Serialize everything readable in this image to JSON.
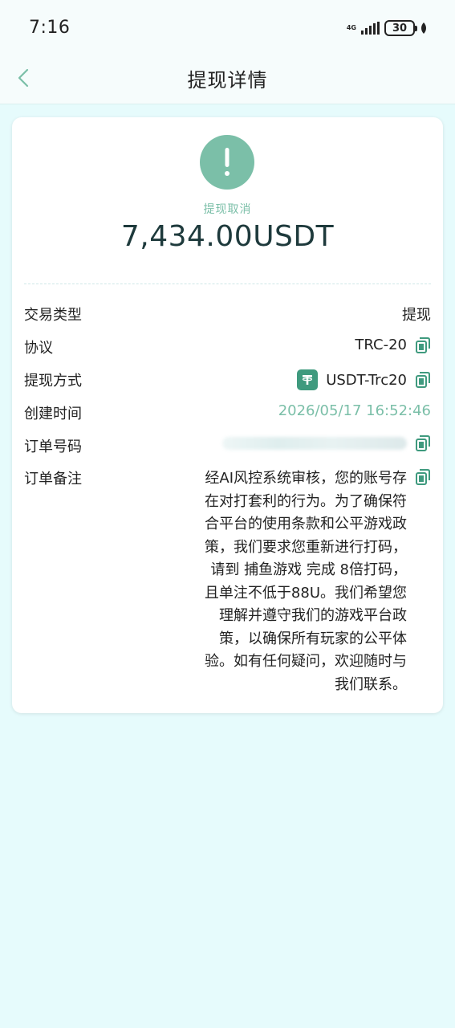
{
  "status_bar": {
    "time": "7:16",
    "network": "4G",
    "battery": "30"
  },
  "header": {
    "title": "提现详情",
    "back_icon": "chevron-left-icon"
  },
  "summary": {
    "status_icon": "exclamation-icon",
    "status_label": "提现取消",
    "amount": "7,434.00USDT",
    "accent_color": "#7bbfa8"
  },
  "details": {
    "type_label": "交易类型",
    "type_value": "提现",
    "protocol_label": "协议",
    "protocol_value": "TRC-20",
    "method_label": "提现方式",
    "method_value": "USDT-Trc20",
    "created_label": "创建时间",
    "created_value": "2026/05/17 16:52:46",
    "order_label": "订单号码",
    "remark_label": "订单备注",
    "remark_value": "经AI风控系统审核，您的账号存在对打套利的行为。为了确保符合平台的使用条款和公平游戏政策，我们要求您重新进行打码，请到 捕鱼游戏 完成 8倍打码，且单注不低于88U。我们希望您理解并遵守我们的游戏平台政策，以确保所有玩家的公平体验。如有任何疑问，欢迎随时与我们联系。"
  }
}
